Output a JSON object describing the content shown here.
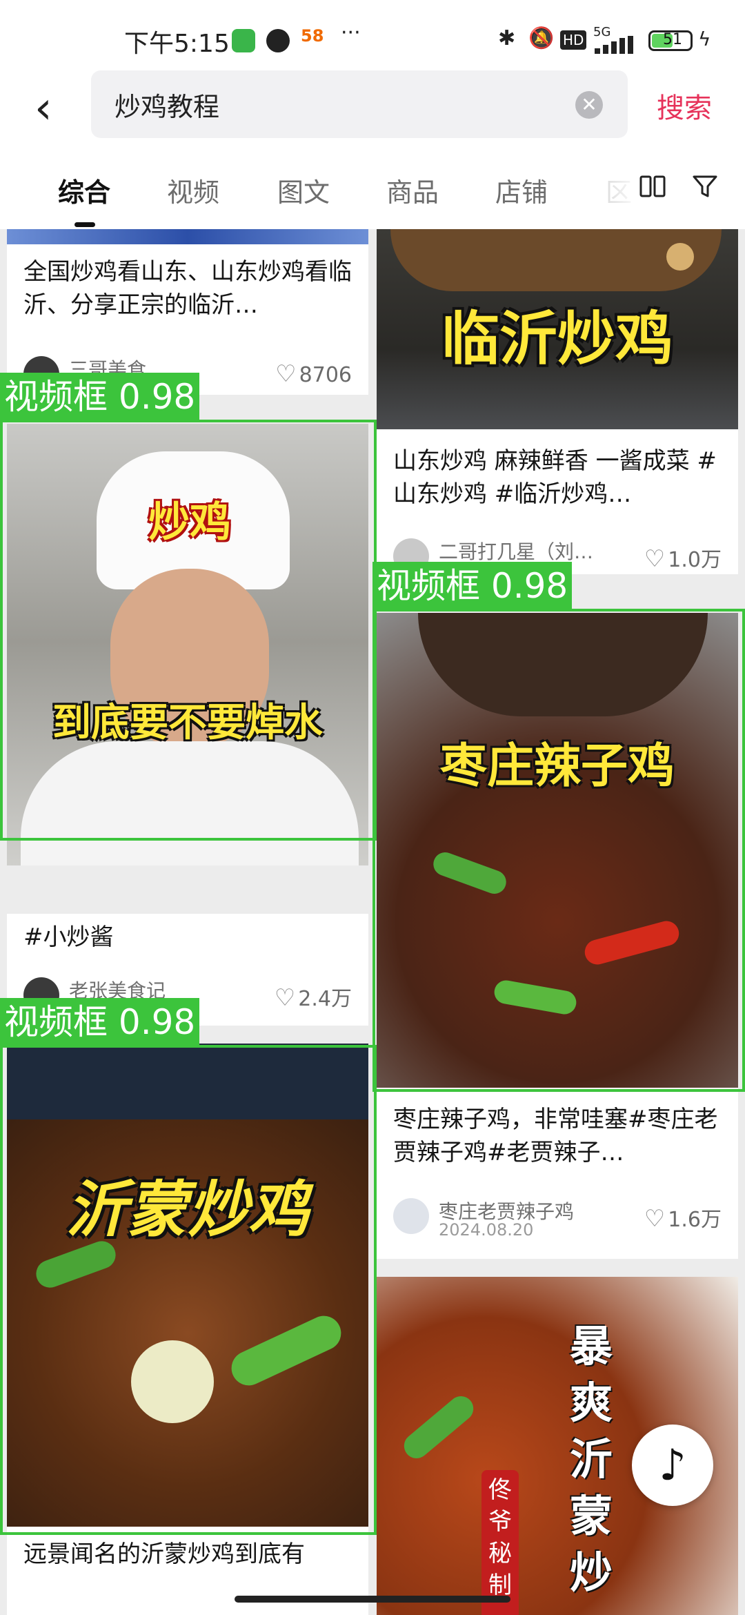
{
  "status_bar": {
    "time": "下午5:15",
    "app1_badge": "58",
    "more": "···",
    "network": "5G",
    "hd": "HD",
    "battery": "51"
  },
  "search": {
    "back_icon": "chevron-left-icon",
    "query": "炒鸡教程",
    "clear_icon": "clear-icon",
    "button": "搜索"
  },
  "tabs": {
    "items": [
      "综合",
      "视频",
      "图文",
      "商品",
      "店铺"
    ],
    "active_index": 0,
    "layout_icon": "grid-layout-icon",
    "filter_icon": "filter-icon"
  },
  "feed": {
    "left": [
      {
        "title": "全国炒鸡看山东、山东炒鸡看临沂、分享正宗的临沂…",
        "author": "三哥美食",
        "likes": "8706"
      },
      {
        "overlay_top": "炒鸡",
        "overlay_bottom": "到底要不要焯水",
        "title": "#小炒酱",
        "author": "老张美食记",
        "likes": "2.4万"
      },
      {
        "overlay": "沂蒙炒鸡",
        "title": "远景闻名的沂蒙炒鸡到底有"
      }
    ],
    "right": [
      {
        "overlay": "临沂炒鸡",
        "title": "山东炒鸡 麻辣鲜香 一酱成菜 #山东炒鸡 #临沂炒鸡…",
        "author": "二哥打几星（刘…",
        "likes": "1.0万"
      },
      {
        "overlay": "枣庄辣子鸡",
        "title": "枣庄辣子鸡，非常哇塞#枣庄老贾辣子鸡#老贾辣子…",
        "author": "枣庄老贾辣子鸡",
        "date": "2024.08.20",
        "likes": "1.6万"
      },
      {
        "overlay_vertical": "暴爽沂蒙炒",
        "overlay_badge": "佟爷秘制"
      }
    ]
  },
  "detections": [
    {
      "label": "视频框 0.98"
    },
    {
      "label": "视频框 0.98"
    },
    {
      "label": "视频框 0.98"
    }
  ],
  "colors": {
    "accent": "#e6325a",
    "detection": "#3cc43c",
    "overlay_yellow": "#ffe83a"
  },
  "floating_icon": "tiktok-logo-icon"
}
